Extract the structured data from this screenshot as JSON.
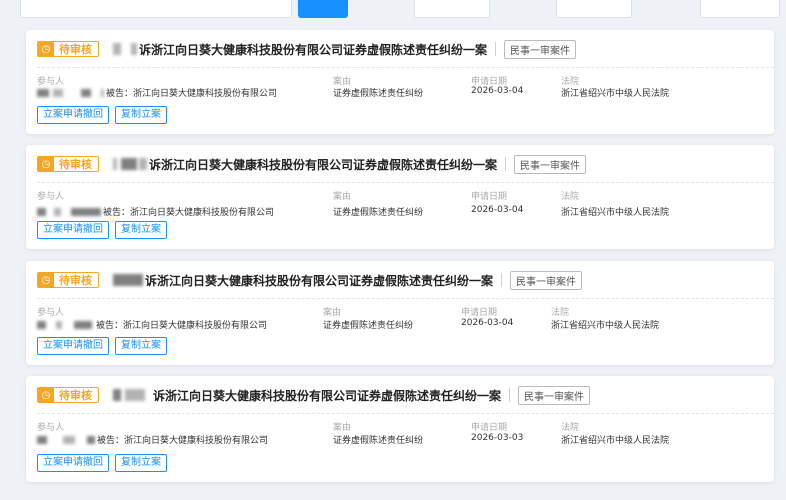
{
  "status_icon": "clock-icon",
  "accent_color": "#1890ff",
  "status_color": "#f5a623",
  "cases": [
    {
      "status": "待审核",
      "title_suffix": "诉浙江向日葵大健康科技股份有限公司证券虚假陈述责任纠纷一案",
      "case_type": "民事一审案件",
      "party_label": "参与人",
      "defendant": "被告：浙江向日葵大健康科技股份有限公司",
      "cause_label": "案由",
      "cause": "证券虚假陈述责任纠纷",
      "date_label": "申请日期",
      "date": "2026-03-04",
      "court_label": "法院",
      "court": "浙江省绍兴市中级人民法院",
      "action_withdraw": "立案申请撤回",
      "action_copy": "复制立案"
    },
    {
      "status": "待审核",
      "title_suffix": "诉浙江向日葵大健康科技股份有限公司证券虚假陈述责任纠纷一案",
      "case_type": "民事一审案件",
      "party_label": "参与人",
      "defendant": "被告：浙江向日葵大健康科技股份有限公司",
      "cause_label": "案由",
      "cause": "证券虚假陈述责任纠纷",
      "date_label": "申请日期",
      "date": "2026-03-04",
      "court_label": "法院",
      "court": "浙江省绍兴市中级人民法院",
      "action_withdraw": "立案申请撤回",
      "action_copy": "复制立案"
    },
    {
      "status": "待审核",
      "title_suffix": "诉浙江向日葵大健康科技股份有限公司证券虚假陈述责任纠纷一案",
      "case_type": "民事一审案件",
      "party_label": "参与人",
      "defendant": "被告：浙江向日葵大健康科技股份有限公司",
      "cause_label": "案由",
      "cause": "证券虚假陈述责任纠纷",
      "date_label": "申请日期",
      "date": "2026-03-04",
      "court_label": "法院",
      "court": "浙江省绍兴市中级人民法院",
      "action_withdraw": "立案申请撤回",
      "action_copy": "复制立案"
    },
    {
      "status": "待审核",
      "title_suffix": "诉浙江向日葵大健康科技股份有限公司证券虚假陈述责任纠纷一案",
      "case_type": "民事一审案件",
      "party_label": "参与人",
      "defendant": "被告：浙江向日葵大健康科技股份有限公司",
      "cause_label": "案由",
      "cause": "证券虚假陈述责任纠纷",
      "date_label": "申请日期",
      "date": "2026-03-03",
      "court_label": "法院",
      "court": "浙江省绍兴市中级人民法院",
      "action_withdraw": "立案申请撤回",
      "action_copy": "复制立案"
    }
  ]
}
